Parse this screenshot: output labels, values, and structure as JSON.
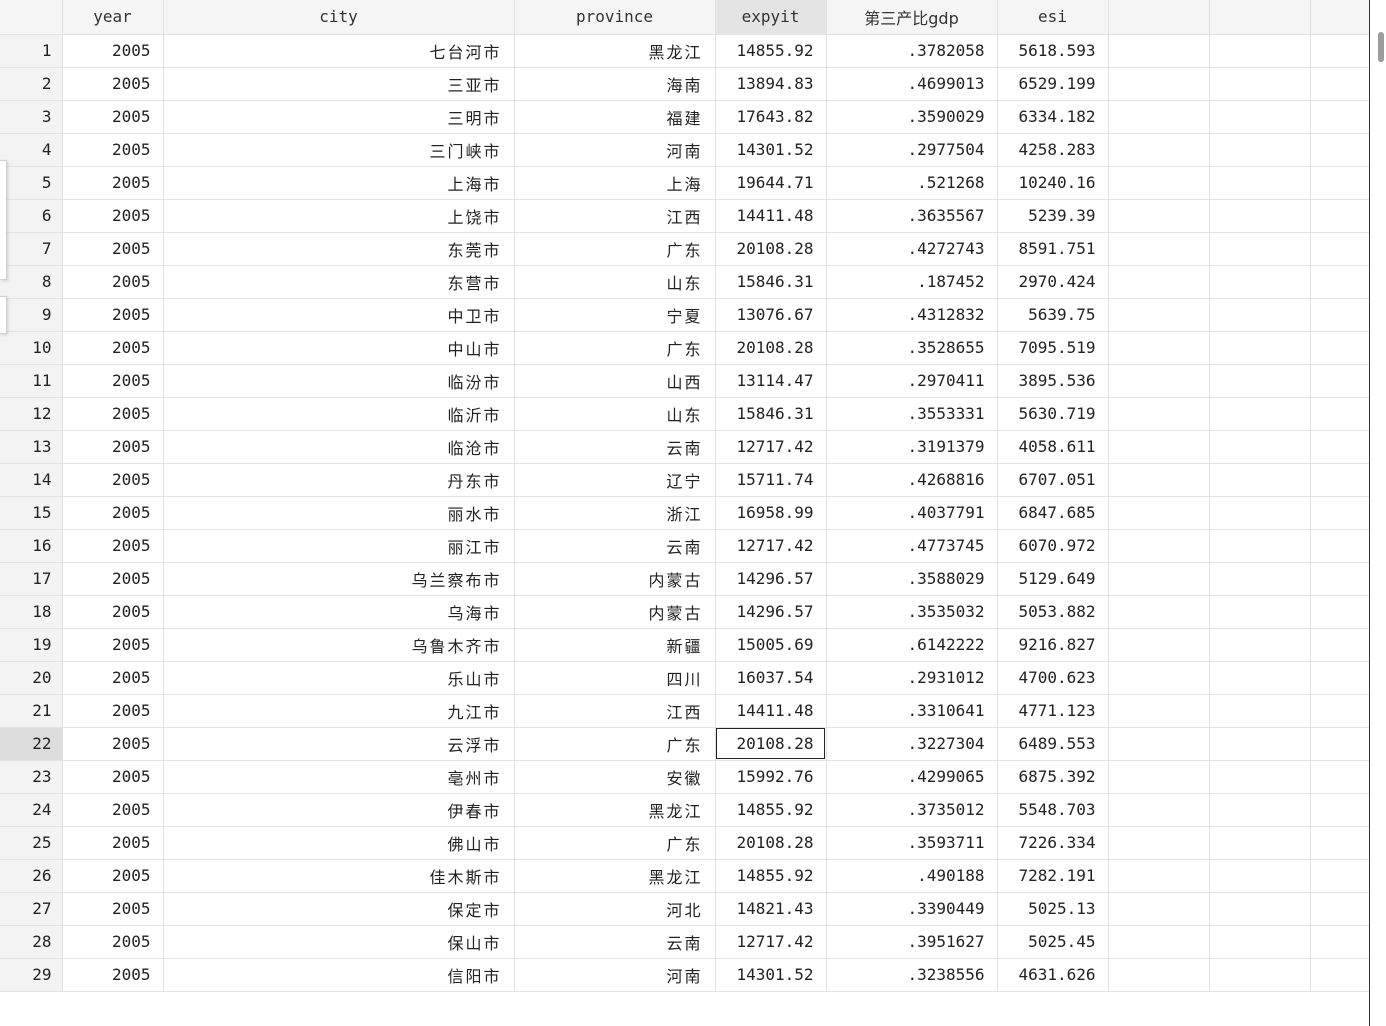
{
  "columns": [
    "year",
    "city",
    "province",
    "expyit",
    "第三产比gdp",
    "esi"
  ],
  "selected_column": "expyit",
  "active_row": 22,
  "rows": [
    {
      "n": "1",
      "year": "2005",
      "city": "七台河市",
      "province": "黑龙江",
      "expyit": "14855.92",
      "gdp": ".3782058",
      "esi": "5618.593"
    },
    {
      "n": "2",
      "year": "2005",
      "city": "三亚市",
      "province": "海南",
      "expyit": "13894.83",
      "gdp": ".4699013",
      "esi": "6529.199"
    },
    {
      "n": "3",
      "year": "2005",
      "city": "三明市",
      "province": "福建",
      "expyit": "17643.82",
      "gdp": ".3590029",
      "esi": "6334.182"
    },
    {
      "n": "4",
      "year": "2005",
      "city": "三门峡市",
      "province": "河南",
      "expyit": "14301.52",
      "gdp": ".2977504",
      "esi": "4258.283"
    },
    {
      "n": "5",
      "year": "2005",
      "city": "上海市",
      "province": "上海",
      "expyit": "19644.71",
      "gdp": ".521268",
      "esi": "10240.16"
    },
    {
      "n": "6",
      "year": "2005",
      "city": "上饶市",
      "province": "江西",
      "expyit": "14411.48",
      "gdp": ".3635567",
      "esi": "5239.39"
    },
    {
      "n": "7",
      "year": "2005",
      "city": "东莞市",
      "province": "广东",
      "expyit": "20108.28",
      "gdp": ".4272743",
      "esi": "8591.751"
    },
    {
      "n": "8",
      "year": "2005",
      "city": "东营市",
      "province": "山东",
      "expyit": "15846.31",
      "gdp": ".187452",
      "esi": "2970.424"
    },
    {
      "n": "9",
      "year": "2005",
      "city": "中卫市",
      "province": "宁夏",
      "expyit": "13076.67",
      "gdp": ".4312832",
      "esi": "5639.75"
    },
    {
      "n": "10",
      "year": "2005",
      "city": "中山市",
      "province": "广东",
      "expyit": "20108.28",
      "gdp": ".3528655",
      "esi": "7095.519"
    },
    {
      "n": "11",
      "year": "2005",
      "city": "临汾市",
      "province": "山西",
      "expyit": "13114.47",
      "gdp": ".2970411",
      "esi": "3895.536"
    },
    {
      "n": "12",
      "year": "2005",
      "city": "临沂市",
      "province": "山东",
      "expyit": "15846.31",
      "gdp": ".3553331",
      "esi": "5630.719"
    },
    {
      "n": "13",
      "year": "2005",
      "city": "临沧市",
      "province": "云南",
      "expyit": "12717.42",
      "gdp": ".3191379",
      "esi": "4058.611"
    },
    {
      "n": "14",
      "year": "2005",
      "city": "丹东市",
      "province": "辽宁",
      "expyit": "15711.74",
      "gdp": ".4268816",
      "esi": "6707.051"
    },
    {
      "n": "15",
      "year": "2005",
      "city": "丽水市",
      "province": "浙江",
      "expyit": "16958.99",
      "gdp": ".4037791",
      "esi": "6847.685"
    },
    {
      "n": "16",
      "year": "2005",
      "city": "丽江市",
      "province": "云南",
      "expyit": "12717.42",
      "gdp": ".4773745",
      "esi": "6070.972"
    },
    {
      "n": "17",
      "year": "2005",
      "city": "乌兰察布市",
      "province": "内蒙古",
      "expyit": "14296.57",
      "gdp": ".3588029",
      "esi": "5129.649"
    },
    {
      "n": "18",
      "year": "2005",
      "city": "乌海市",
      "province": "内蒙古",
      "expyit": "14296.57",
      "gdp": ".3535032",
      "esi": "5053.882"
    },
    {
      "n": "19",
      "year": "2005",
      "city": "乌鲁木齐市",
      "province": "新疆",
      "expyit": "15005.69",
      "gdp": ".6142222",
      "esi": "9216.827"
    },
    {
      "n": "20",
      "year": "2005",
      "city": "乐山市",
      "province": "四川",
      "expyit": "16037.54",
      "gdp": ".2931012",
      "esi": "4700.623"
    },
    {
      "n": "21",
      "year": "2005",
      "city": "九江市",
      "province": "江西",
      "expyit": "14411.48",
      "gdp": ".3310641",
      "esi": "4771.123"
    },
    {
      "n": "22",
      "year": "2005",
      "city": "云浮市",
      "province": "广东",
      "expyit": "20108.28",
      "gdp": ".3227304",
      "esi": "6489.553"
    },
    {
      "n": "23",
      "year": "2005",
      "city": "亳州市",
      "province": "安徽",
      "expyit": "15992.76",
      "gdp": ".4299065",
      "esi": "6875.392"
    },
    {
      "n": "24",
      "year": "2005",
      "city": "伊春市",
      "province": "黑龙江",
      "expyit": "14855.92",
      "gdp": ".3735012",
      "esi": "5548.703"
    },
    {
      "n": "25",
      "year": "2005",
      "city": "佛山市",
      "province": "广东",
      "expyit": "20108.28",
      "gdp": ".3593711",
      "esi": "7226.334"
    },
    {
      "n": "26",
      "year": "2005",
      "city": "佳木斯市",
      "province": "黑龙江",
      "expyit": "14855.92",
      "gdp": ".490188",
      "esi": "7282.191"
    },
    {
      "n": "27",
      "year": "2005",
      "city": "保定市",
      "province": "河北",
      "expyit": "14821.43",
      "gdp": ".3390449",
      "esi": "5025.13"
    },
    {
      "n": "28",
      "year": "2005",
      "city": "保山市",
      "province": "云南",
      "expyit": "12717.42",
      "gdp": ".3951627",
      "esi": "5025.45"
    },
    {
      "n": "29",
      "year": "2005",
      "city": "信阳市",
      "province": "河南",
      "expyit": "14301.52",
      "gdp": ".3238556",
      "esi": "4631.626"
    }
  ]
}
